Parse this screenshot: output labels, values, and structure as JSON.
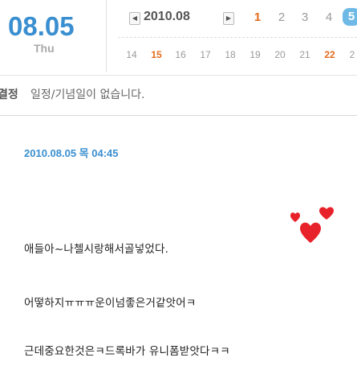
{
  "header": {
    "big_date": "08.05",
    "weekday": "Thu",
    "calendar": {
      "month_label": "2010.08",
      "prev_icon": "◀",
      "next_icon": "▶",
      "row1": [
        {
          "day": "1",
          "style": "red"
        },
        {
          "day": "2",
          "style": "normal"
        },
        {
          "day": "3",
          "style": "normal"
        },
        {
          "day": "4",
          "style": "normal"
        },
        {
          "day": "5",
          "style": "today"
        }
      ],
      "row2": [
        {
          "day": "14",
          "style": "normal"
        },
        {
          "day": "15",
          "style": "red"
        },
        {
          "day": "16",
          "style": "normal"
        },
        {
          "day": "17",
          "style": "normal"
        },
        {
          "day": "18",
          "style": "normal"
        },
        {
          "day": "19",
          "style": "normal"
        },
        {
          "day": "20",
          "style": "normal"
        },
        {
          "day": "21",
          "style": "normal"
        },
        {
          "day": "22",
          "style": "red"
        },
        {
          "day": "2",
          "style": "normal"
        }
      ]
    }
  },
  "notice": {
    "label": "결정",
    "text": "일정/기념일이 없습니다."
  },
  "post": {
    "date": "2010.08.05 목 04:45",
    "lines": [
      "애들아~나첼시랑해서골넣었다.",
      "어떻하지ㅠㅠㅠ운이넘좋은거같앗어ㅋ",
      "근데중요한것은ㅋ드록바가 유니폼받앗다ㅋㅋ"
    ]
  },
  "colors": {
    "accent": "#3a8fd0",
    "red_day": "#e36b1f",
    "today_bg": "#6fb9e6",
    "heart": "#e8222a"
  }
}
